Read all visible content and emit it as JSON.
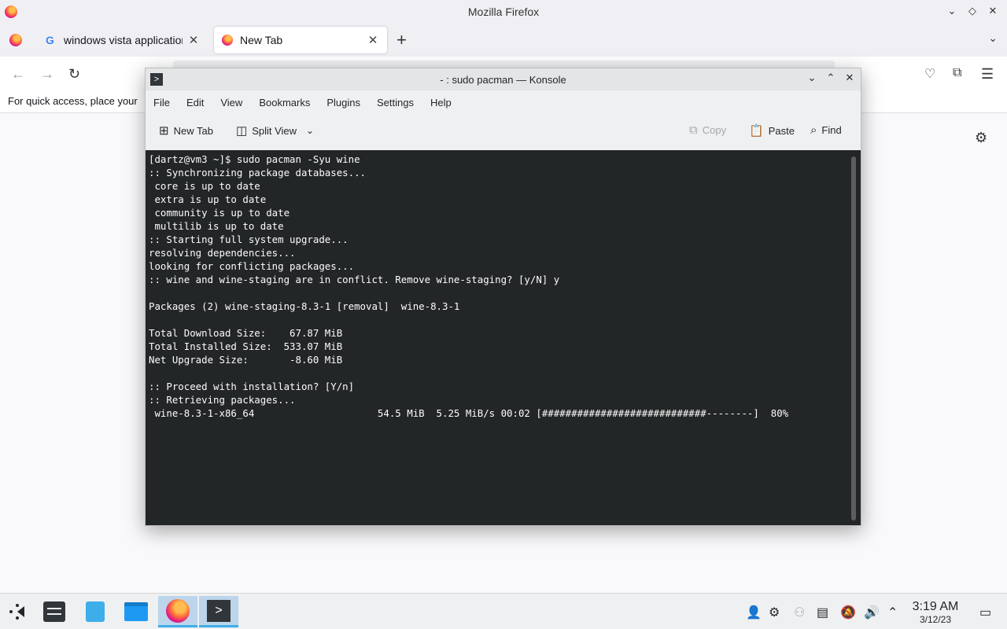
{
  "firefox": {
    "window_title": "Mozilla Firefox",
    "tabs": [
      {
        "label": "windows vista applications",
        "close": "✕"
      },
      {
        "label": "New Tab",
        "close": "✕"
      }
    ],
    "new_tab_symbol": "+",
    "bookmarks_toolbar_hint": "For quick access, place your"
  },
  "konsole": {
    "title": "- : sudo pacman — Konsole",
    "menu": [
      "File",
      "Edit",
      "View",
      "Bookmarks",
      "Plugins",
      "Settings",
      "Help"
    ],
    "toolbar": {
      "new_tab": "New Tab",
      "split_view": "Split View",
      "copy": "Copy",
      "paste": "Paste",
      "find": "Find"
    },
    "terminal_lines": [
      "[dartz@vm3 ~]$ sudo pacman -Syu wine",
      ":: Synchronizing package databases...",
      " core is up to date",
      " extra is up to date",
      " community is up to date",
      " multilib is up to date",
      ":: Starting full system upgrade...",
      "resolving dependencies...",
      "looking for conflicting packages...",
      ":: wine and wine-staging are in conflict. Remove wine-staging? [y/N] y",
      "",
      "Packages (2) wine-staging-8.3-1 [removal]  wine-8.3-1",
      "",
      "Total Download Size:    67.87 MiB",
      "Total Installed Size:  533.07 MiB",
      "Net Upgrade Size:       -8.60 MiB",
      "",
      ":: Proceed with installation? [Y/n]",
      ":: Retrieving packages...",
      " wine-8.3-1-x86_64                     54.5 MiB  5.25 MiB/s 00:02 [############################--------]  80%"
    ],
    "download_progress_percent": 80
  },
  "taskbar": {
    "clock_time": "3:19 AM",
    "clock_date": "3/12/23"
  }
}
